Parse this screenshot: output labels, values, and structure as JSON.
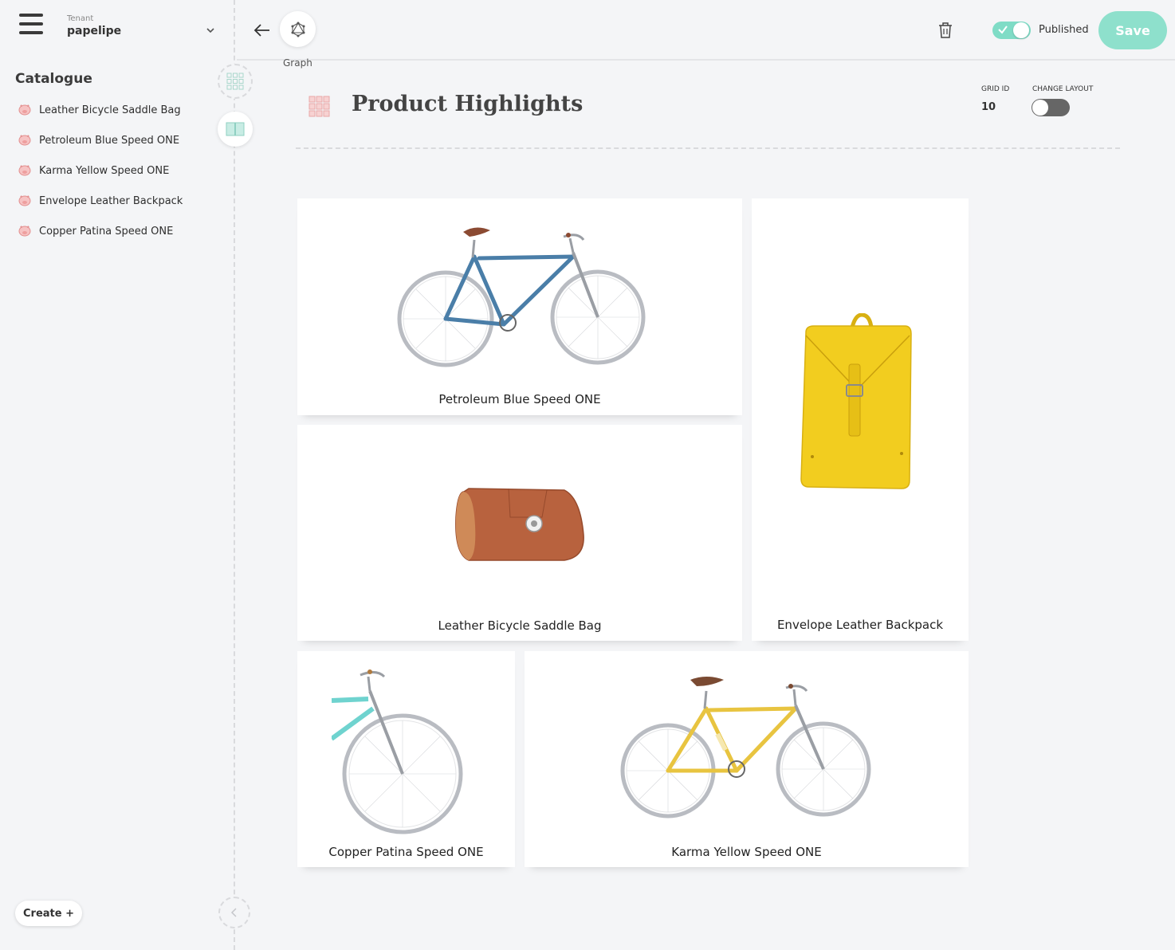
{
  "sidebar": {
    "tenant_label": "Tenant",
    "tenant_name": "papelipe",
    "catalogue_title": "Catalogue",
    "items": [
      {
        "label": "Leather Bicycle Saddle Bag"
      },
      {
        "label": "Petroleum Blue Speed ONE"
      },
      {
        "label": "Karma Yellow Speed ONE"
      },
      {
        "label": "Envelope Leather Backpack"
      },
      {
        "label": "Copper Patina Speed ONE"
      }
    ],
    "create_label": "Create +"
  },
  "topbar": {
    "graph_label": "Graph",
    "published_label": "Published",
    "published": true,
    "save_label": "Save"
  },
  "header": {
    "title": "Product Highlights",
    "grid_id_label": "GRID ID",
    "grid_id_value": "10",
    "change_layout_label": "CHANGE LAYOUT",
    "change_layout_on": false
  },
  "tiles": {
    "petroleum": {
      "label": "Petroleum Blue Speed ONE",
      "icon": "blue-bicycle-image"
    },
    "backpack": {
      "label": "Envelope Leather Backpack",
      "icon": "yellow-backpack-image"
    },
    "saddle": {
      "label": "Leather Bicycle Saddle Bag",
      "icon": "saddle-bag-image"
    },
    "copper": {
      "label": "Copper Patina Speed ONE",
      "icon": "teal-bicycle-image"
    },
    "karma": {
      "label": "Karma Yellow Speed ONE",
      "icon": "yellow-bicycle-image"
    }
  },
  "colors": {
    "accent": "#7fdcc6",
    "save": "#8ee0cc",
    "blue_bike": "#4a7ea8",
    "yellow_bike": "#e8c440",
    "teal_bike": "#6fd3cf",
    "backpack": "#f2cd1f",
    "saddle_bag": "#b8623e"
  }
}
